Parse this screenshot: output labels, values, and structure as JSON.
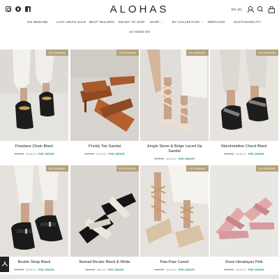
{
  "header": {
    "logo": "ALOHAS",
    "language": "EN (€)",
    "social": [
      "instagram-icon",
      "pinterest-icon",
      "facebook-icon"
    ]
  },
  "nav": {
    "items": [
      {
        "label": "ON DEMAND",
        "chevron": ""
      },
      {
        "label": "LAST UNITS SALE",
        "chevron": ""
      },
      {
        "label": "BEST SELLERS",
        "chevron": ""
      },
      {
        "label": "READY TO SHIP",
        "chevron": ""
      },
      {
        "label": "SHOP",
        "chevron": "›"
      },
      {
        "label": "BY COLLECTION",
        "chevron": "›"
      },
      {
        "label": "MERCADO",
        "chevron": ""
      },
      {
        "label": "SUSTAINABILITY",
        "chevron": ""
      }
    ],
    "second_row": "AS SEEN ON"
  },
  "products": [
    {
      "name": "Fireplace Chain Black",
      "name2": "",
      "badge": "ON DEMAND",
      "old": "$170.00",
      "new": "$130.00",
      "tag": "PRE ORDER"
    },
    {
      "name": "Prickly Tan Sandal",
      "name2": "",
      "badge": "ON DEMAND",
      "old": "$170.00",
      "new": "$130.00",
      "tag": "PRE ORDER"
    },
    {
      "name": "Jungle Stone & Beige Laced Up",
      "name2": "Sandal",
      "badge": "ON DEMAND",
      "old": "$170.00",
      "new": "$130.00",
      "tag": "PRE ORDER"
    },
    {
      "name": "Marshmallow Check Black",
      "name2": "",
      "badge": "ON DEMAND",
      "old": "$170.00",
      "new": "$130.00",
      "tag": "PRE ORDER"
    },
    {
      "name": "Buckle Strap Black",
      "name2": "",
      "badge": "ON DEMAND",
      "old": "$170.00",
      "new": "$130.00",
      "tag": "PRE ORDER"
    },
    {
      "name": "Nomad Bicolor Black & White",
      "name2": "",
      "badge": "ON DEMAND",
      "old": "$116.00",
      "new": "$83.00",
      "tag": "PRE ORDER"
    },
    {
      "name": "Paw-Paw Camel",
      "name2": "",
      "badge": "ON DEMAND",
      "old": "$180.00",
      "new": "$130.00",
      "tag": "PRE ORDER"
    },
    {
      "name": "Dune Himalayan Pink",
      "name2": "",
      "badge": "ON DEMAND",
      "old": "$170.00",
      "new": "$130.00",
      "tag": "PRE ORDER"
    }
  ],
  "colors": {
    "badge": "#b4a27b",
    "preorder": "#2aa05a",
    "text": "#222222"
  }
}
